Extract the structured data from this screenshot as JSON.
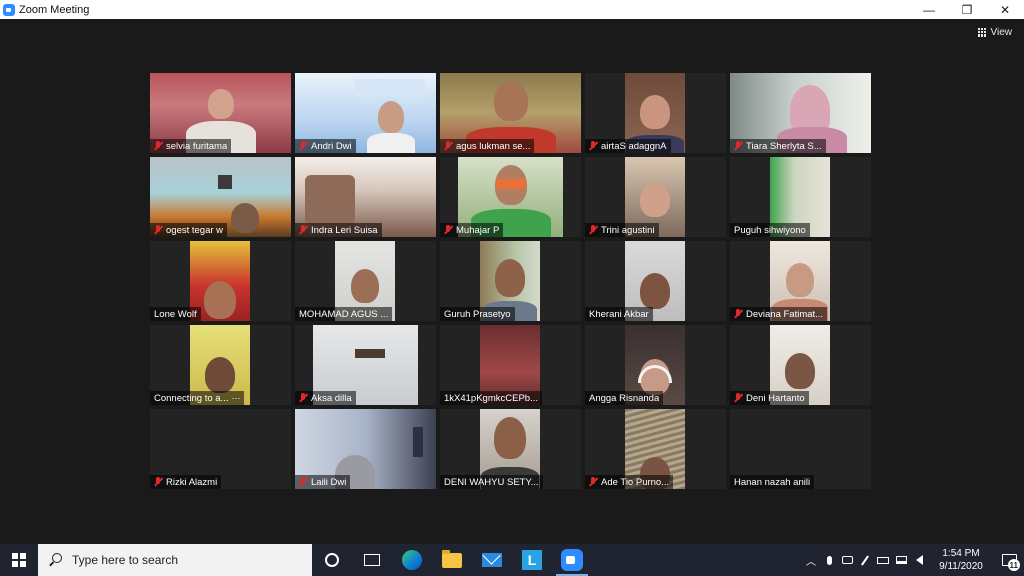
{
  "window": {
    "title": "Zoom Meeting",
    "minimize_glyph": "—",
    "restore_glyph": "❐",
    "close_glyph": "✕"
  },
  "toolbar": {
    "view_label": "View"
  },
  "participants": [
    {
      "name": "selvia furitama",
      "muted": true
    },
    {
      "name": "Andri Dwi",
      "muted": true
    },
    {
      "name": "agus lukman se...",
      "muted": true
    },
    {
      "name": "airtaS adaggnA",
      "muted": true
    },
    {
      "name": "Tiara Sherlyta S...",
      "muted": true
    },
    {
      "name": "ogest tegar w",
      "muted": true
    },
    {
      "name": "Indra Leri Suisa",
      "muted": true
    },
    {
      "name": "Muhajar P",
      "muted": true
    },
    {
      "name": "Trini agustini",
      "muted": true
    },
    {
      "name": "Puguh sihwiyono",
      "muted": false
    },
    {
      "name": "Lone Wolf",
      "muted": false
    },
    {
      "name": "MOHAMAD AGUS ...",
      "muted": false
    },
    {
      "name": "Guruh Prasetyo",
      "muted": false
    },
    {
      "name": "Kherani Akbar",
      "muted": false
    },
    {
      "name": "Deviana Fatimat...",
      "muted": true
    },
    {
      "name": "Connecting to a...",
      "muted": false
    },
    {
      "name": "Aksa dilla",
      "muted": true
    },
    {
      "name": "1kX41pKgmkcCEPb...",
      "muted": false
    },
    {
      "name": "Angga Risnanda",
      "muted": false
    },
    {
      "name": "Deni Hartanto",
      "muted": true
    },
    {
      "name": "Rizki Alazmi",
      "muted": true
    },
    {
      "name": "Laili Dwi",
      "muted": true
    },
    {
      "name": "DENI WAHYU SETY...",
      "muted": false
    },
    {
      "name": "Ade Tio Purno...",
      "muted": true
    },
    {
      "name": "Hanan nazah anili",
      "muted": false
    }
  ],
  "taskbar": {
    "search_placeholder": "Type here to search",
    "l_app_letter": "L",
    "time": "1:54 PM",
    "date": "9/11/2020",
    "notification_count": "11",
    "tray_chevron": "︿"
  },
  "colors": {
    "zoom_blue": "#2d8cff",
    "muted_red": "#e02828",
    "taskbar": "#1f2430"
  }
}
